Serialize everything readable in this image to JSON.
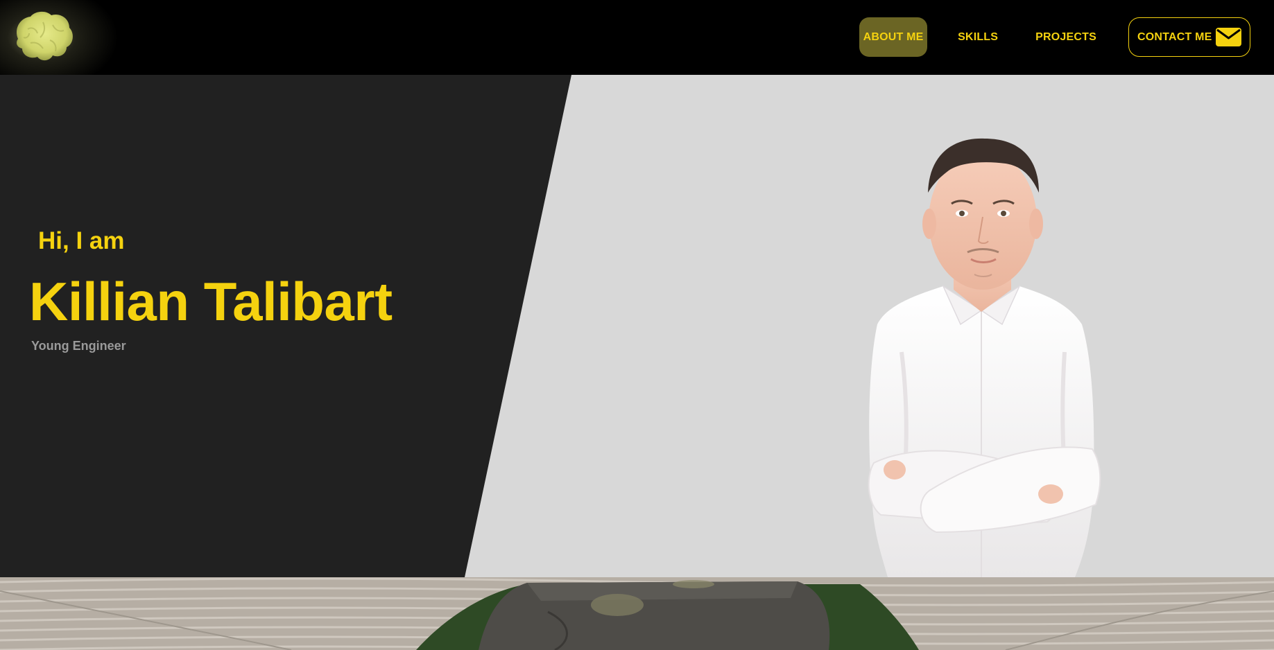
{
  "nav": {
    "items": [
      {
        "label": "ABOUT ME",
        "active": true
      },
      {
        "label": "SKILLS",
        "active": false
      },
      {
        "label": "PROJECTS",
        "active": false
      },
      {
        "label": "CONTACT ME",
        "active": false,
        "icon": "mail-icon"
      }
    ]
  },
  "hero": {
    "greeting": "Hi, I am",
    "name": "Killian Talibart",
    "role": "Young Engineer"
  },
  "colors": {
    "accent": "#f5d20f",
    "nav_bg": "#000000",
    "hero_dark": "#212121",
    "hero_light": "#d8d8d8",
    "active_nav_bg": "#6b6524",
    "role_text": "#9a9a9a"
  }
}
